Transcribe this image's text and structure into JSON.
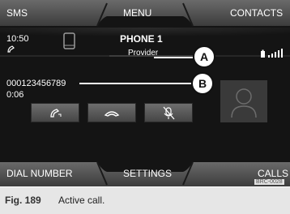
{
  "top_tabs": {
    "left": "SMS",
    "center": "MENU",
    "right": "CONTACTS"
  },
  "bottom_tabs": {
    "left": "DIAL NUMBER",
    "center": "SETTINGS",
    "right": "CALLS"
  },
  "status": {
    "time": "10:50"
  },
  "phone": {
    "title": "PHONE 1",
    "provider": "Provider"
  },
  "call": {
    "number": "000123456789",
    "duration": "0:06"
  },
  "callouts": {
    "a": "A",
    "b": "B"
  },
  "image_ref": "BRC-0028",
  "caption": {
    "figure": "Fig. 189",
    "text": "Active call."
  },
  "icons": {
    "handset": "handset-icon",
    "phone_device": "phone-device-icon",
    "battery": "battery-icon",
    "signal": "signal-bars-icon",
    "handset_transfer": "handset-transfer-icon",
    "hang_up": "hang-up-icon",
    "mute": "microphone-mute-icon",
    "contact_photo": "contact-avatar-icon"
  },
  "colors": {
    "screen_bg": "#141414",
    "accent": "#ffffff",
    "button": "#5a5a5a"
  }
}
